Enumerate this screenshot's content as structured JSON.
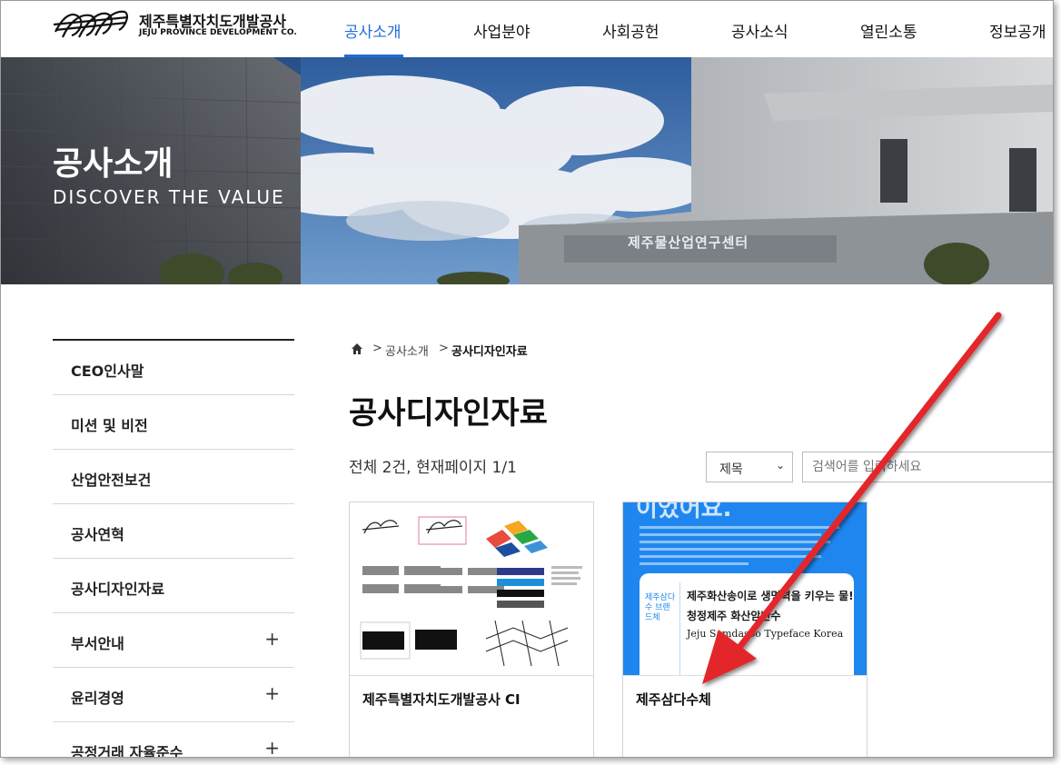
{
  "header": {
    "logo_ko": "제주특별자치도개발공사",
    "logo_en": "JEJU PROVINCE DEVELOPMENT CO.",
    "nav": [
      "공사소개",
      "사업분야",
      "사회공헌",
      "공사소식",
      "열린소통",
      "정보공개"
    ],
    "active_nav": "공사소개",
    "accent": "#1f6fd6"
  },
  "hero": {
    "title": "공사소개",
    "subtitle": "DISCOVER THE VALUE",
    "building_sign": "제주물산업연구센터"
  },
  "sidebar": {
    "items": [
      {
        "label": "CEO인사말",
        "expandable": false
      },
      {
        "label": "미션 및 비전",
        "expandable": false
      },
      {
        "label": "산업안전보건",
        "expandable": false
      },
      {
        "label": "공사연혁",
        "expandable": false
      },
      {
        "label": "공사디자인자료",
        "expandable": false
      },
      {
        "label": "부서안내",
        "expandable": true
      },
      {
        "label": "윤리경영",
        "expandable": true
      },
      {
        "label": "공정거래 자율준수",
        "expandable": true
      }
    ],
    "plus_symbol": "+"
  },
  "breadcrumb": {
    "home_icon": "home-icon",
    "separator": ">",
    "items": [
      "공사소개",
      "공사디자인자료"
    ]
  },
  "main": {
    "page_title": "공사디자인자료",
    "count_text": "전체 2건, 현재페이지 1/1",
    "search": {
      "select_value": "제목",
      "placeholder": "검색어를 입력하세요"
    },
    "cards": [
      {
        "title": "제주특별자치도개발공사 CI"
      },
      {
        "title": "제주삼다수체"
      }
    ],
    "card2_preview": {
      "heading": "이었어요.",
      "line1": "제주화산송이로 생명력을 키우는 물!",
      "line2": "청정제주 화산암반수",
      "line3": "Jeju Samdasoo Typeface Korea",
      "badge": "제주삼다수 브랜드체"
    }
  },
  "annotation": {
    "arrow_color": "#e3262b"
  }
}
